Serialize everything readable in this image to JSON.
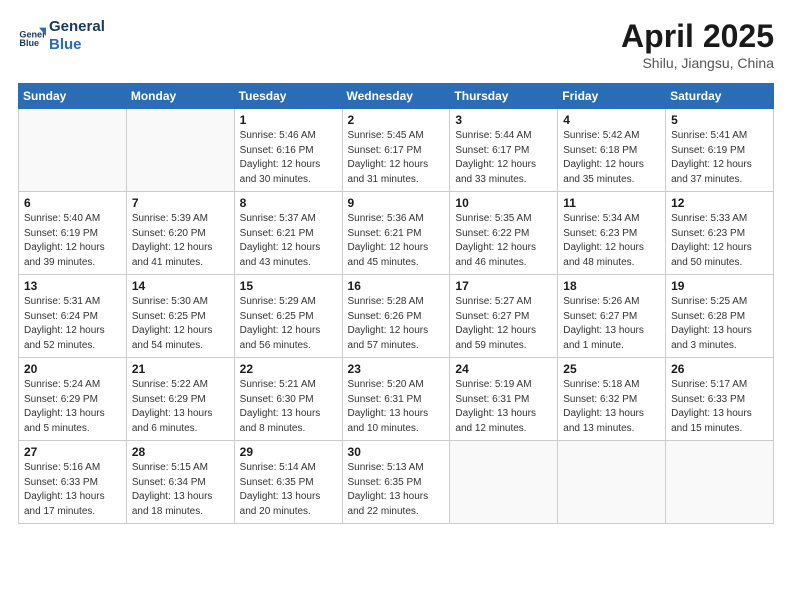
{
  "header": {
    "logo_line1": "General",
    "logo_line2": "Blue",
    "month": "April 2025",
    "location": "Shilu, Jiangsu, China"
  },
  "days_of_week": [
    "Sunday",
    "Monday",
    "Tuesday",
    "Wednesday",
    "Thursday",
    "Friday",
    "Saturday"
  ],
  "weeks": [
    [
      {
        "num": "",
        "detail": ""
      },
      {
        "num": "",
        "detail": ""
      },
      {
        "num": "1",
        "detail": "Sunrise: 5:46 AM\nSunset: 6:16 PM\nDaylight: 12 hours\nand 30 minutes."
      },
      {
        "num": "2",
        "detail": "Sunrise: 5:45 AM\nSunset: 6:17 PM\nDaylight: 12 hours\nand 31 minutes."
      },
      {
        "num": "3",
        "detail": "Sunrise: 5:44 AM\nSunset: 6:17 PM\nDaylight: 12 hours\nand 33 minutes."
      },
      {
        "num": "4",
        "detail": "Sunrise: 5:42 AM\nSunset: 6:18 PM\nDaylight: 12 hours\nand 35 minutes."
      },
      {
        "num": "5",
        "detail": "Sunrise: 5:41 AM\nSunset: 6:19 PM\nDaylight: 12 hours\nand 37 minutes."
      }
    ],
    [
      {
        "num": "6",
        "detail": "Sunrise: 5:40 AM\nSunset: 6:19 PM\nDaylight: 12 hours\nand 39 minutes."
      },
      {
        "num": "7",
        "detail": "Sunrise: 5:39 AM\nSunset: 6:20 PM\nDaylight: 12 hours\nand 41 minutes."
      },
      {
        "num": "8",
        "detail": "Sunrise: 5:37 AM\nSunset: 6:21 PM\nDaylight: 12 hours\nand 43 minutes."
      },
      {
        "num": "9",
        "detail": "Sunrise: 5:36 AM\nSunset: 6:21 PM\nDaylight: 12 hours\nand 45 minutes."
      },
      {
        "num": "10",
        "detail": "Sunrise: 5:35 AM\nSunset: 6:22 PM\nDaylight: 12 hours\nand 46 minutes."
      },
      {
        "num": "11",
        "detail": "Sunrise: 5:34 AM\nSunset: 6:23 PM\nDaylight: 12 hours\nand 48 minutes."
      },
      {
        "num": "12",
        "detail": "Sunrise: 5:33 AM\nSunset: 6:23 PM\nDaylight: 12 hours\nand 50 minutes."
      }
    ],
    [
      {
        "num": "13",
        "detail": "Sunrise: 5:31 AM\nSunset: 6:24 PM\nDaylight: 12 hours\nand 52 minutes."
      },
      {
        "num": "14",
        "detail": "Sunrise: 5:30 AM\nSunset: 6:25 PM\nDaylight: 12 hours\nand 54 minutes."
      },
      {
        "num": "15",
        "detail": "Sunrise: 5:29 AM\nSunset: 6:25 PM\nDaylight: 12 hours\nand 56 minutes."
      },
      {
        "num": "16",
        "detail": "Sunrise: 5:28 AM\nSunset: 6:26 PM\nDaylight: 12 hours\nand 57 minutes."
      },
      {
        "num": "17",
        "detail": "Sunrise: 5:27 AM\nSunset: 6:27 PM\nDaylight: 12 hours\nand 59 minutes."
      },
      {
        "num": "18",
        "detail": "Sunrise: 5:26 AM\nSunset: 6:27 PM\nDaylight: 13 hours\nand 1 minute."
      },
      {
        "num": "19",
        "detail": "Sunrise: 5:25 AM\nSunset: 6:28 PM\nDaylight: 13 hours\nand 3 minutes."
      }
    ],
    [
      {
        "num": "20",
        "detail": "Sunrise: 5:24 AM\nSunset: 6:29 PM\nDaylight: 13 hours\nand 5 minutes."
      },
      {
        "num": "21",
        "detail": "Sunrise: 5:22 AM\nSunset: 6:29 PM\nDaylight: 13 hours\nand 6 minutes."
      },
      {
        "num": "22",
        "detail": "Sunrise: 5:21 AM\nSunset: 6:30 PM\nDaylight: 13 hours\nand 8 minutes."
      },
      {
        "num": "23",
        "detail": "Sunrise: 5:20 AM\nSunset: 6:31 PM\nDaylight: 13 hours\nand 10 minutes."
      },
      {
        "num": "24",
        "detail": "Sunrise: 5:19 AM\nSunset: 6:31 PM\nDaylight: 13 hours\nand 12 minutes."
      },
      {
        "num": "25",
        "detail": "Sunrise: 5:18 AM\nSunset: 6:32 PM\nDaylight: 13 hours\nand 13 minutes."
      },
      {
        "num": "26",
        "detail": "Sunrise: 5:17 AM\nSunset: 6:33 PM\nDaylight: 13 hours\nand 15 minutes."
      }
    ],
    [
      {
        "num": "27",
        "detail": "Sunrise: 5:16 AM\nSunset: 6:33 PM\nDaylight: 13 hours\nand 17 minutes."
      },
      {
        "num": "28",
        "detail": "Sunrise: 5:15 AM\nSunset: 6:34 PM\nDaylight: 13 hours\nand 18 minutes."
      },
      {
        "num": "29",
        "detail": "Sunrise: 5:14 AM\nSunset: 6:35 PM\nDaylight: 13 hours\nand 20 minutes."
      },
      {
        "num": "30",
        "detail": "Sunrise: 5:13 AM\nSunset: 6:35 PM\nDaylight: 13 hours\nand 22 minutes."
      },
      {
        "num": "",
        "detail": ""
      },
      {
        "num": "",
        "detail": ""
      },
      {
        "num": "",
        "detail": ""
      }
    ]
  ]
}
